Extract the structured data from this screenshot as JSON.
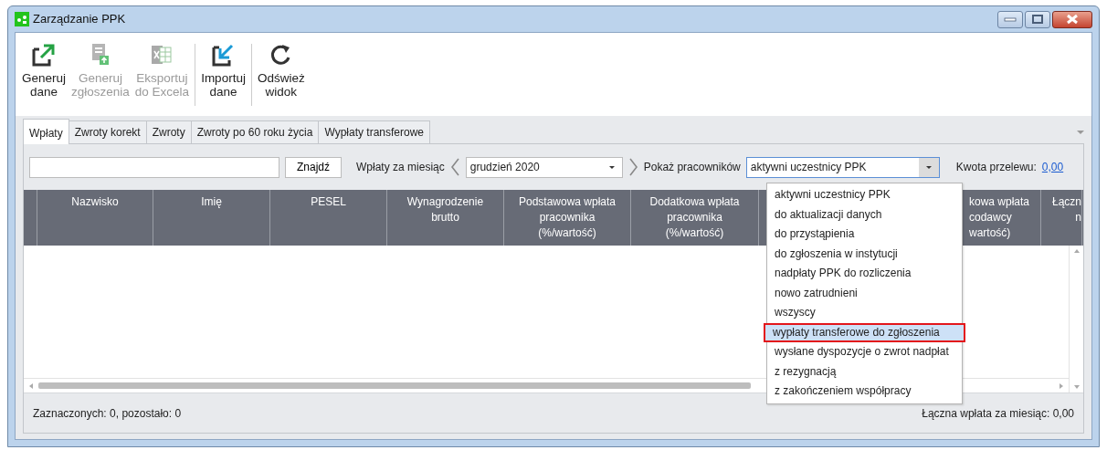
{
  "window": {
    "title": "Zarządzanie PPK"
  },
  "toolbar": [
    {
      "label": "Generuj dane",
      "disabled": false
    },
    {
      "label": "Generuj zgłoszenia",
      "disabled": true
    },
    {
      "label": "Eksportuj do Excela",
      "disabled": true
    },
    {
      "label": "Importuj dane",
      "disabled": false
    },
    {
      "label": "Odśwież widok",
      "disabled": false
    }
  ],
  "tabs": [
    {
      "label": "Wpłaty",
      "selected": true
    },
    {
      "label": "Zwroty korekt",
      "selected": false
    },
    {
      "label": "Zwroty",
      "selected": false
    },
    {
      "label": "Zwroty po 60 roku życia",
      "selected": false
    },
    {
      "label": "Wypłaty transferowe",
      "selected": false
    }
  ],
  "filters": {
    "search_button": "Znajdź",
    "month_label": "Wpłaty za miesiąc",
    "month": "grudzień 2020",
    "employees_label": "Pokaż pracowników",
    "employees": "aktywni uczestnicy PPK",
    "transfer_label": "Kwota przelewu:",
    "transfer_amount": "0,00"
  },
  "dropdown": {
    "expanded": true,
    "items": [
      {
        "label": "aktywni uczestnicy PPK",
        "selected": false
      },
      {
        "label": "do aktualizacji danych",
        "selected": false
      },
      {
        "label": "do przystąpienia",
        "selected": false
      },
      {
        "label": "do zgłoszenia w instytucji",
        "selected": false
      },
      {
        "label": "nadpłaty PPK do rozliczenia",
        "selected": false
      },
      {
        "label": "nowo zatrudnieni",
        "selected": false
      },
      {
        "label": "wszyscy",
        "selected": false
      },
      {
        "label": "wypłaty transferowe do zgłoszenia",
        "selected": true
      },
      {
        "label": "wysłane dyspozycje o zwrot nadpłat",
        "selected": false
      },
      {
        "label": "z rezygnacją",
        "selected": false
      },
      {
        "label": "z zakończeniem współpracy",
        "selected": false
      }
    ]
  },
  "table": {
    "columns": [
      {
        "lines": [
          "Nazwisko"
        ]
      },
      {
        "lines": [
          "Imię"
        ]
      },
      {
        "lines": [
          "PESEL"
        ]
      },
      {
        "lines": [
          "Wynagrodzenie",
          "brutto"
        ]
      },
      {
        "lines": [
          "Podstawowa wpłata",
          "pracownika",
          "(%/wartość)"
        ]
      },
      {
        "lines": [
          "Dodatkowa wpłata",
          "pracownika",
          "(%/wartość)"
        ]
      },
      {
        "lines": [
          "kowa wpłata",
          "codawcy",
          "wartość)"
        ]
      },
      {
        "lines": [
          "Łączn",
          "n"
        ]
      }
    ]
  },
  "status_bar": {
    "left": "Zaznaczonych: 0, pozostało: 0",
    "right": "Łączna wpłata za miesiąc: 0,00"
  }
}
